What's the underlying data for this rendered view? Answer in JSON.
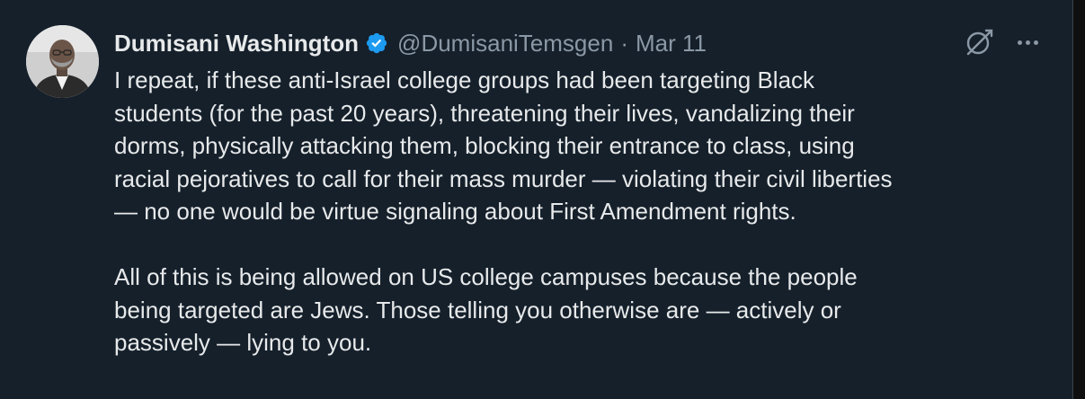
{
  "author": {
    "name": "Dumisani Washington",
    "handle": "@DumisaniTemsgen",
    "separator": "·",
    "date": "Mar 11",
    "verified": true,
    "avatar_icon": "profile-photo"
  },
  "actions": {
    "grok_icon": "grok-icon",
    "more_icon": "more-options-icon"
  },
  "tweet": {
    "paragraph_1": "I repeat, if these anti-Israel college groups had been targeting Black\nstudents (for the past 20 years), threatening their lives, vandalizing their\ndorms, physically attacking them, blocking their entrance to class, using\nracial pejoratives to call for their mass murder — violating their civil liberties\n— no one would be virtue signaling about First Amendment rights.",
    "paragraph_2": "All of this is being allowed on US college campuses because the people\nbeing targeted are Jews. Those telling you otherwise are — actively or\npassively — lying to you."
  },
  "colors": {
    "background": "#15202b",
    "text": "#e7e9ea",
    "muted": "#8b98a5",
    "verified": "#1d9bf0"
  }
}
